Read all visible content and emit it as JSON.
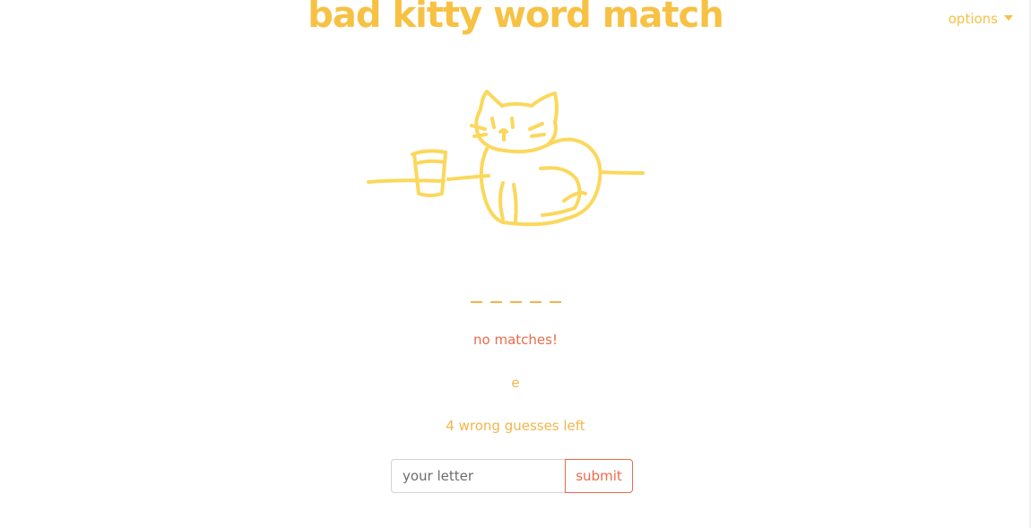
{
  "header": {
    "title": "bad kitty word match",
    "options_label": "options"
  },
  "game": {
    "blank_count": 5,
    "feedback": "no matches!",
    "guessed_letters": "e",
    "guesses_left_text": "4 wrong guesses left"
  },
  "form": {
    "input_placeholder": "your letter",
    "input_value": "",
    "submit_label": "submit"
  },
  "colors": {
    "title": "#f7c143",
    "accent": "#f3b54a",
    "alert": "#ec6a4b",
    "illustration": "#fbd85c"
  },
  "icons": {
    "options_caret": "caret-down-icon",
    "illustration": "cat-with-cup-illustration"
  }
}
